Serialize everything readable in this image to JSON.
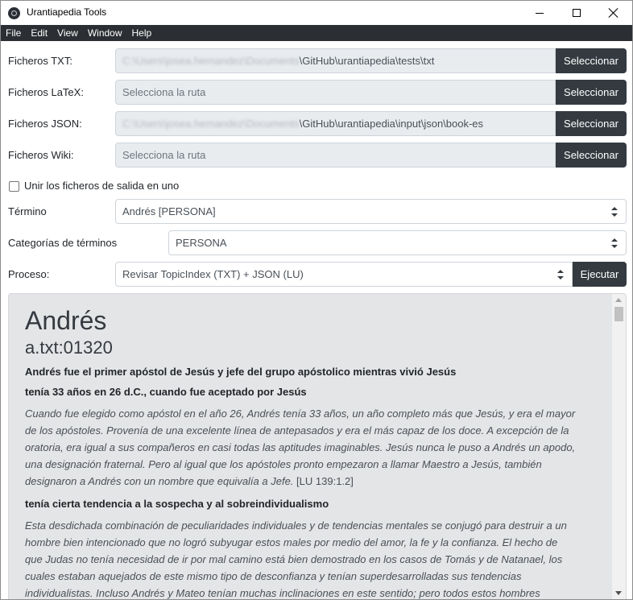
{
  "window": {
    "title": "Urantiapedia Tools"
  },
  "menu": [
    "File",
    "Edit",
    "View",
    "Window",
    "Help"
  ],
  "rows": {
    "txt": {
      "label": "Ficheros TXT:",
      "path_blurred": "C:\\Users\\josea.hernandez\\Documents",
      "path_visible": "\\GitHub\\urantiapedia\\tests\\txt",
      "button": "Seleccionar"
    },
    "latex": {
      "label": "Ficheros LaTeX:",
      "placeholder": "Selecciona la ruta",
      "button": "Seleccionar"
    },
    "json": {
      "label": "Ficheros JSON:",
      "path_blurred": "C:\\Users\\josea.hernandez\\Documents",
      "path_visible": "\\GitHub\\urantiapedia\\input\\json\\book-es",
      "button": "Seleccionar"
    },
    "wiki": {
      "label": "Ficheros Wiki:",
      "placeholder": "Selecciona la ruta",
      "button": "Seleccionar"
    }
  },
  "merge_checkbox": {
    "label": "Unir los ficheros de salida en uno",
    "checked": false
  },
  "termino": {
    "label": "Término",
    "value": "Andrés [PERSONA]"
  },
  "categorias": {
    "label": "Categorías de términos",
    "value": "PERSONA"
  },
  "proceso": {
    "label": "Proceso:",
    "value": "Revisar TopicIndex (TXT) + JSON (LU)",
    "button": "Ejecutar"
  },
  "result": {
    "title": "Andrés",
    "subtitle": "a.txt:01320",
    "heading1": "Andrés fue el primer apóstol de Jesús y jefe del grupo apóstolico mientras vivió Jesús",
    "heading2": "tenía 33 años en 26 d.C., cuando fue aceptado por Jesús",
    "para1_lines": [
      "Cuando fue elegido como apóstol en el año 26, Andrés tenía 33 años, un año completo más que Jesús, y era el mayor",
      "de los apóstoles. Provenía de una excelente línea de antepasados y era el más capaz de los doce. A excepción de la",
      "oratoria, era igual a sus compañeros en casi todas las aptitudes imaginables. Jesús nunca le puso a Andrés un apodo,",
      "una designación fraternal. Pero al igual que los apóstoles pronto empezaron a llamar Maestro a Jesús, también",
      "designaron a Andrés con un nombre que equivalía a Jefe."
    ],
    "para1_ref": "[LU 139:1.2]",
    "heading3": "tenía cierta tendencia a la sospecha y al sobreindividualismo",
    "para2_lines": [
      "Esta desdichada combinación de peculiaridades individuales y de tendencias mentales se conjugó para destruir a un",
      "hombre bien intencionado que no logró subyugar estos males por medio del amor, la fe y la confianza. El hecho de",
      "que Judas no tenía necesidad de ir por mal camino está bien demostrado en los casos de Tomás y de Natanael, los",
      "cuales estaban aquejados de este mismo tipo de desconfianza y tenían superdesarrolladas sus tendencias",
      "individualistas. Incluso Andrés y Mateo tenían muchas inclinaciones en este sentido; pero todos estos hombres"
    ]
  }
}
